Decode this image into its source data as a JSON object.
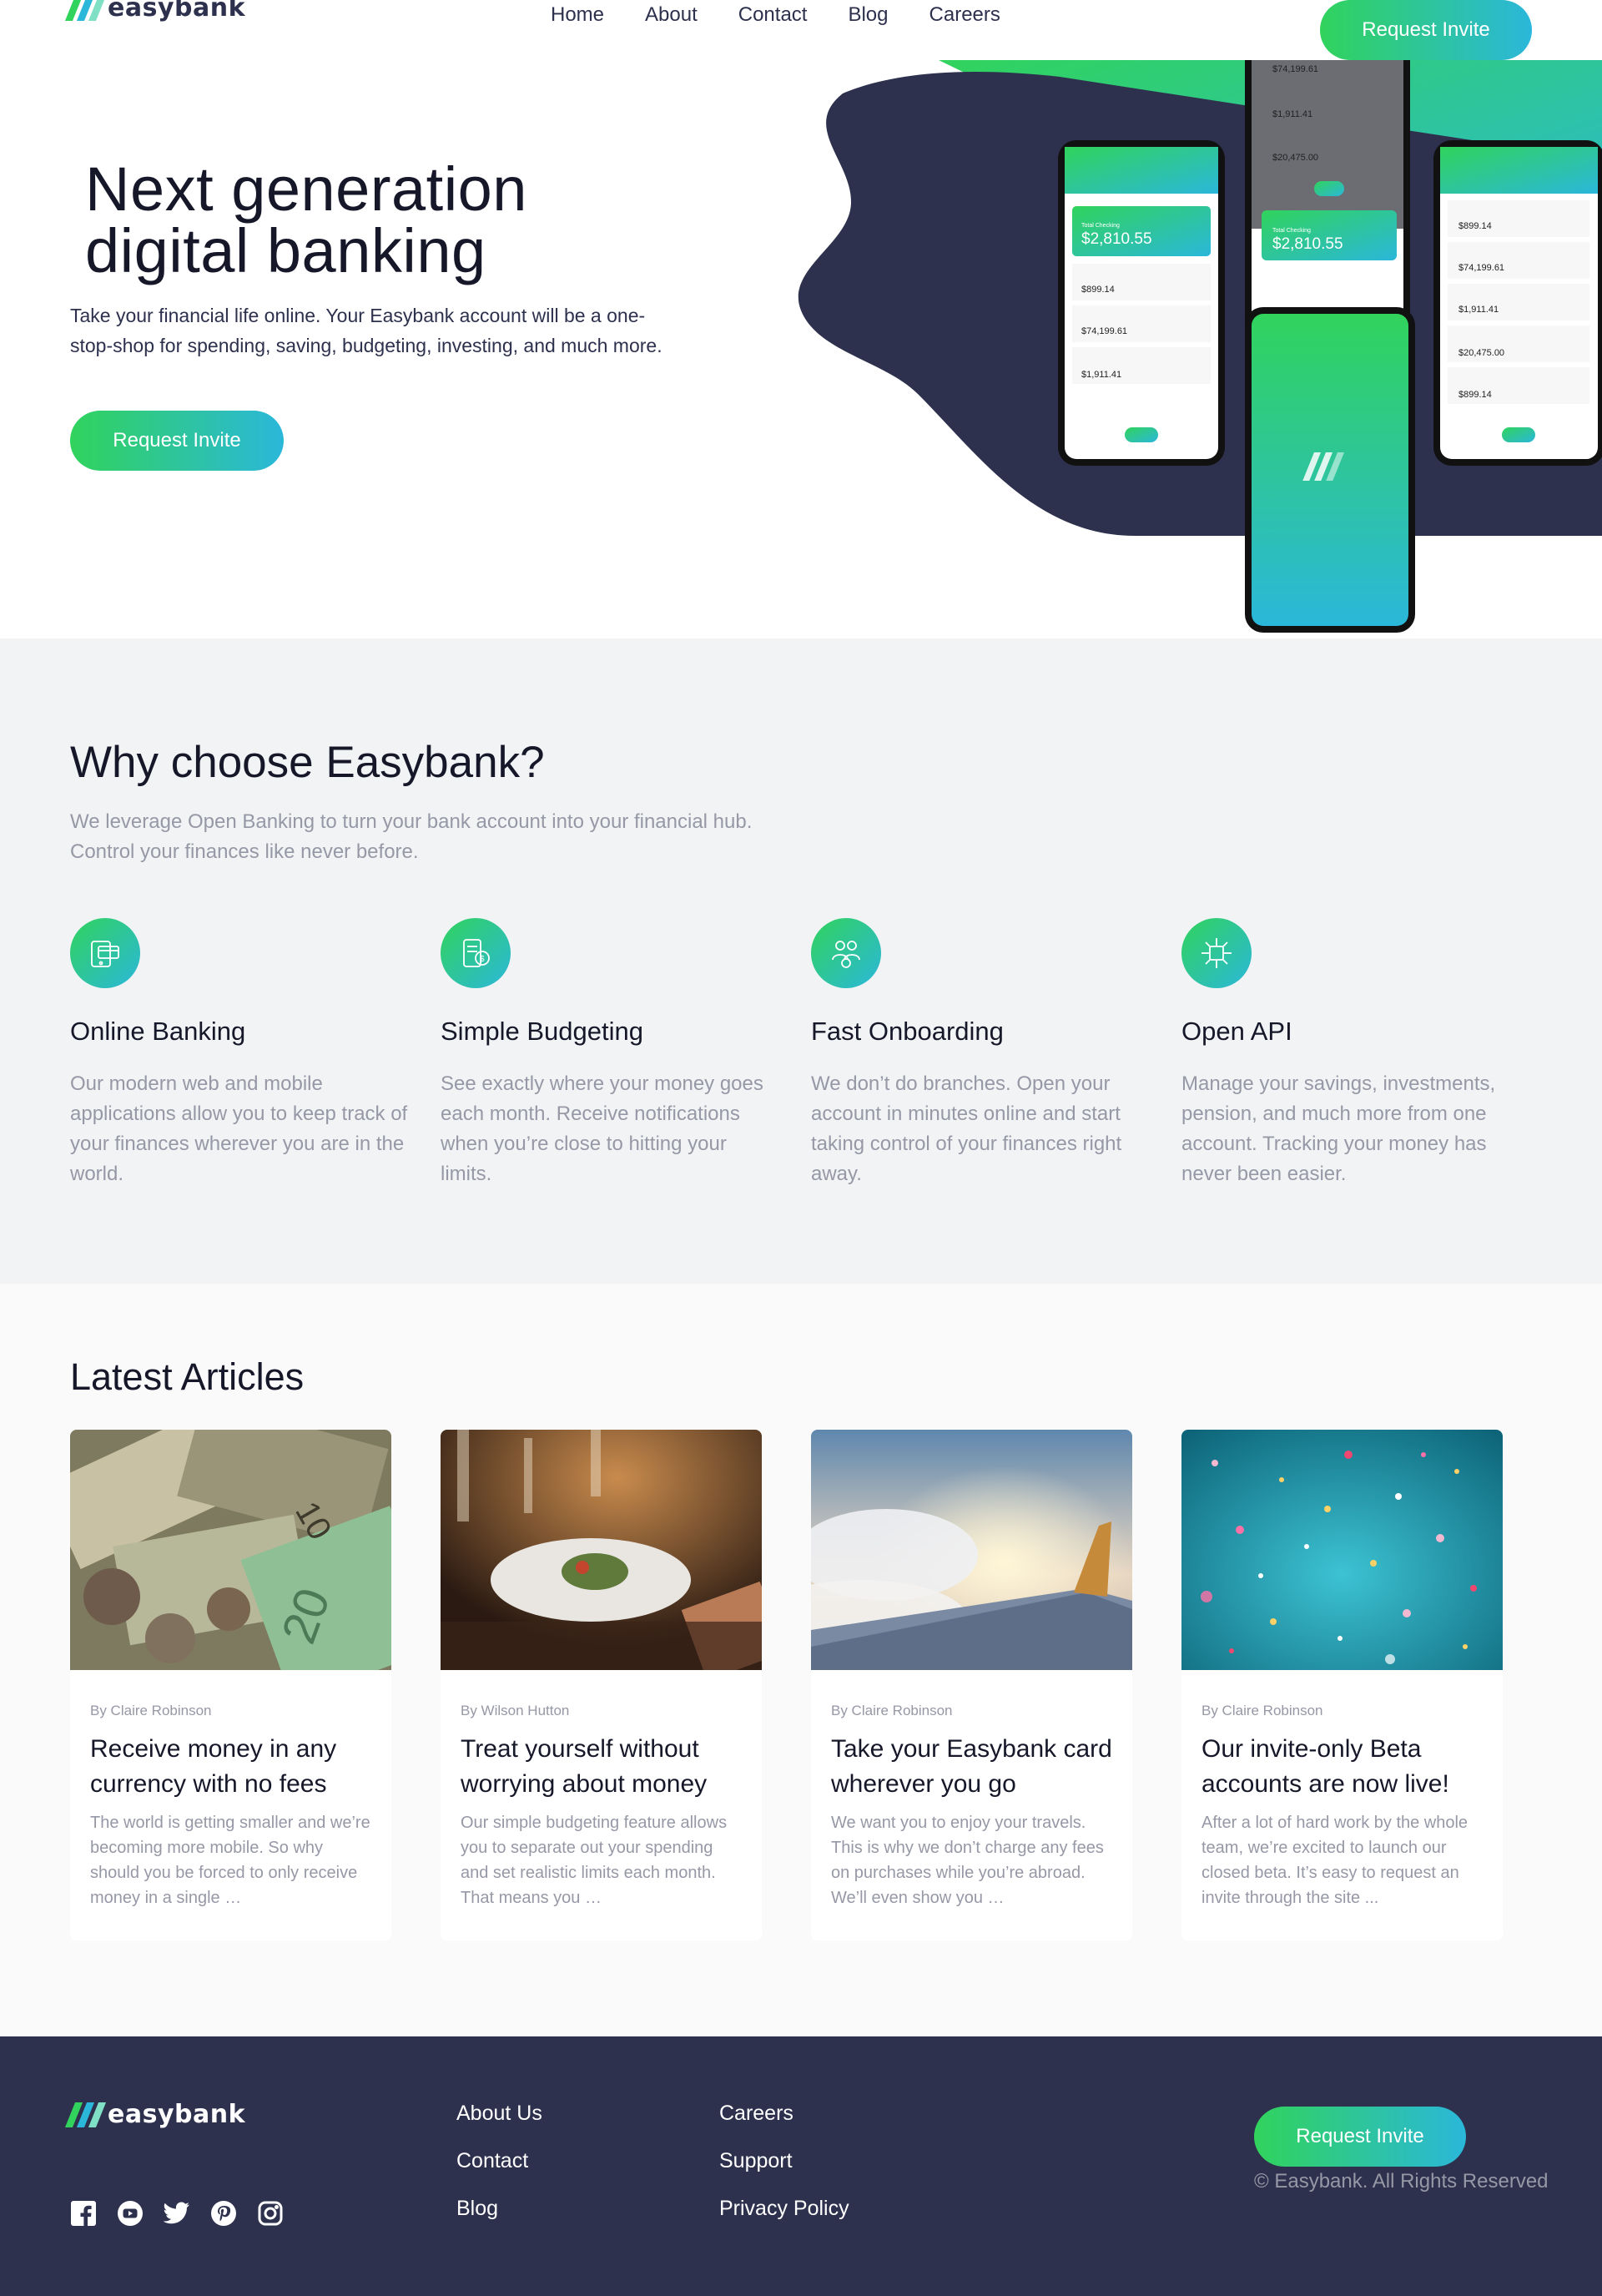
{
  "brand": {
    "name": "easybank"
  },
  "nav": {
    "links": [
      "Home",
      "About",
      "Contact",
      "Blog",
      "Careers"
    ],
    "cta": "Request Invite"
  },
  "hero": {
    "title_line1": "Next generation",
    "title_line2": "digital banking",
    "text": "Take your financial life online. Your Easybank account will be a one-stop-shop for spending, saving, budgeting, investing, and much more.",
    "cta": "Request Invite",
    "phones": {
      "total_label": "Total Checking",
      "total": "$2,810.55",
      "accounts": [
        "$899.14",
        "$74,199.61",
        "$1,911.41",
        "$20,475.00"
      ]
    }
  },
  "why": {
    "title": "Why choose Easybank?",
    "intro": "We leverage Open Banking to turn your bank account into your financial hub. Control your finances like never before.",
    "features": [
      {
        "title": "Online Banking",
        "icon": "online-banking-icon",
        "text": "Our modern web and mobile applications allow you to keep track of your finances wherever you are in the world."
      },
      {
        "title": "Simple Budgeting",
        "icon": "budgeting-icon",
        "text": "See exactly where your money goes each month. Receive notifications when you’re close to hitting your limits."
      },
      {
        "title": "Fast Onboarding",
        "icon": "onboarding-icon",
        "text": "We don’t do branches. Open your account in minutes online and start taking control of your finances right away."
      },
      {
        "title": "Open API",
        "icon": "api-icon",
        "text": "Manage your savings, investments, pension, and much more from one account. Tracking your money has never been easier."
      }
    ]
  },
  "articles": {
    "title": "Latest Articles",
    "items": [
      {
        "author": "By Claire Robinson",
        "title": "Receive money in any currency with no fees",
        "excerpt": "The world is getting smaller and we’re becoming more mobile. So why should you be forced to only receive money in a single …",
        "image": "currency-image"
      },
      {
        "author": "By Wilson Hutton",
        "title": "Treat yourself without worrying about money",
        "excerpt": "Our simple budgeting feature allows you to separate out your spending and set realistic limits each month. That means you …",
        "image": "restaurant-image"
      },
      {
        "author": "By Claire Robinson",
        "title": "Take your Easybank card wherever you go",
        "excerpt": "We want you to enjoy your travels. This is why we don’t charge any fees on purchases while you’re abroad. We’ll even show you …",
        "image": "plane-image"
      },
      {
        "author": "By Claire Robinson",
        "title": "Our invite-only Beta accounts are now live!",
        "excerpt": "After a lot of hard work by the whole team, we’re excited to launch our closed beta. It’s easy to request an invite through the site ...",
        "image": "confetti-image"
      }
    ]
  },
  "footer": {
    "col1": [
      "About Us",
      "Contact",
      "Blog"
    ],
    "col2": [
      "Careers",
      "Support",
      "Privacy Policy"
    ],
    "cta": "Request Invite",
    "copyright": "© Easybank. All Rights Reserved",
    "socials": [
      "facebook-icon",
      "youtube-icon",
      "twitter-icon",
      "pinterest-icon",
      "instagram-icon"
    ]
  },
  "colors": {
    "dark_blue": "#2d314d",
    "lime_green": "#31d35c",
    "bright_cyan": "#2bb7da",
    "grayish_blue": "#9698a6",
    "light_gray": "#f2f3f5"
  }
}
